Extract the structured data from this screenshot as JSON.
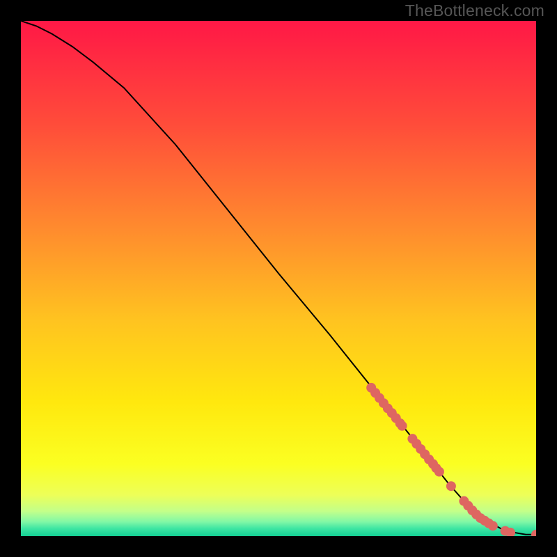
{
  "branding": {
    "watermark": "TheBottleneck.com"
  },
  "palette": {
    "gradient_stops": [
      {
        "offset": 0.0,
        "color": "#ff1846"
      },
      {
        "offset": 0.2,
        "color": "#ff4c3a"
      },
      {
        "offset": 0.4,
        "color": "#ff8a2e"
      },
      {
        "offset": 0.58,
        "color": "#ffc320"
      },
      {
        "offset": 0.74,
        "color": "#ffe80e"
      },
      {
        "offset": 0.86,
        "color": "#fbff22"
      },
      {
        "offset": 0.92,
        "color": "#edff58"
      },
      {
        "offset": 0.952,
        "color": "#c2ff8a"
      },
      {
        "offset": 0.972,
        "color": "#82f8a6"
      },
      {
        "offset": 0.985,
        "color": "#3fe6a3"
      },
      {
        "offset": 1.0,
        "color": "#13cf94"
      }
    ],
    "frame": "#000000",
    "curve": "#000000",
    "dot": "#de6661"
  },
  "chart_data": {
    "type": "line",
    "title": "",
    "xlabel": "",
    "ylabel": "",
    "xlim": [
      0,
      100
    ],
    "ylim": [
      0,
      100
    ],
    "grid": false,
    "legend": false,
    "series": [
      {
        "name": "curve",
        "kind": "line",
        "x": [
          0,
          3,
          6,
          10,
          14,
          20,
          30,
          40,
          50,
          60,
          70,
          76,
          80,
          83,
          86,
          90,
          94,
          98,
          100
        ],
        "y": [
          100,
          99,
          97.5,
          95,
          92,
          87,
          76,
          63.5,
          51,
          39,
          26.5,
          19,
          14,
          10.2,
          6.8,
          3.2,
          1.0,
          0.3,
          0.3
        ]
      },
      {
        "name": "highlighted-points",
        "kind": "scatter",
        "x": [
          68.0,
          68.8,
          69.6,
          70.4,
          71.2,
          72.0,
          72.8,
          73.6,
          74.0,
          76.0,
          76.8,
          77.6,
          78.4,
          79.2,
          80.0,
          80.6,
          81.2,
          83.5,
          86.0,
          86.8,
          87.6,
          88.4,
          89.2,
          90.0,
          90.8,
          91.6,
          94.0,
          95.0,
          100.0
        ],
        "y": [
          28.8,
          27.8,
          26.8,
          25.8,
          24.8,
          23.9,
          22.9,
          21.9,
          21.4,
          18.9,
          17.9,
          16.9,
          15.9,
          14.9,
          14.0,
          13.2,
          12.5,
          9.7,
          6.8,
          5.9,
          5.0,
          4.2,
          3.5,
          3.0,
          2.5,
          2.0,
          1.0,
          0.7,
          0.3
        ]
      }
    ]
  }
}
